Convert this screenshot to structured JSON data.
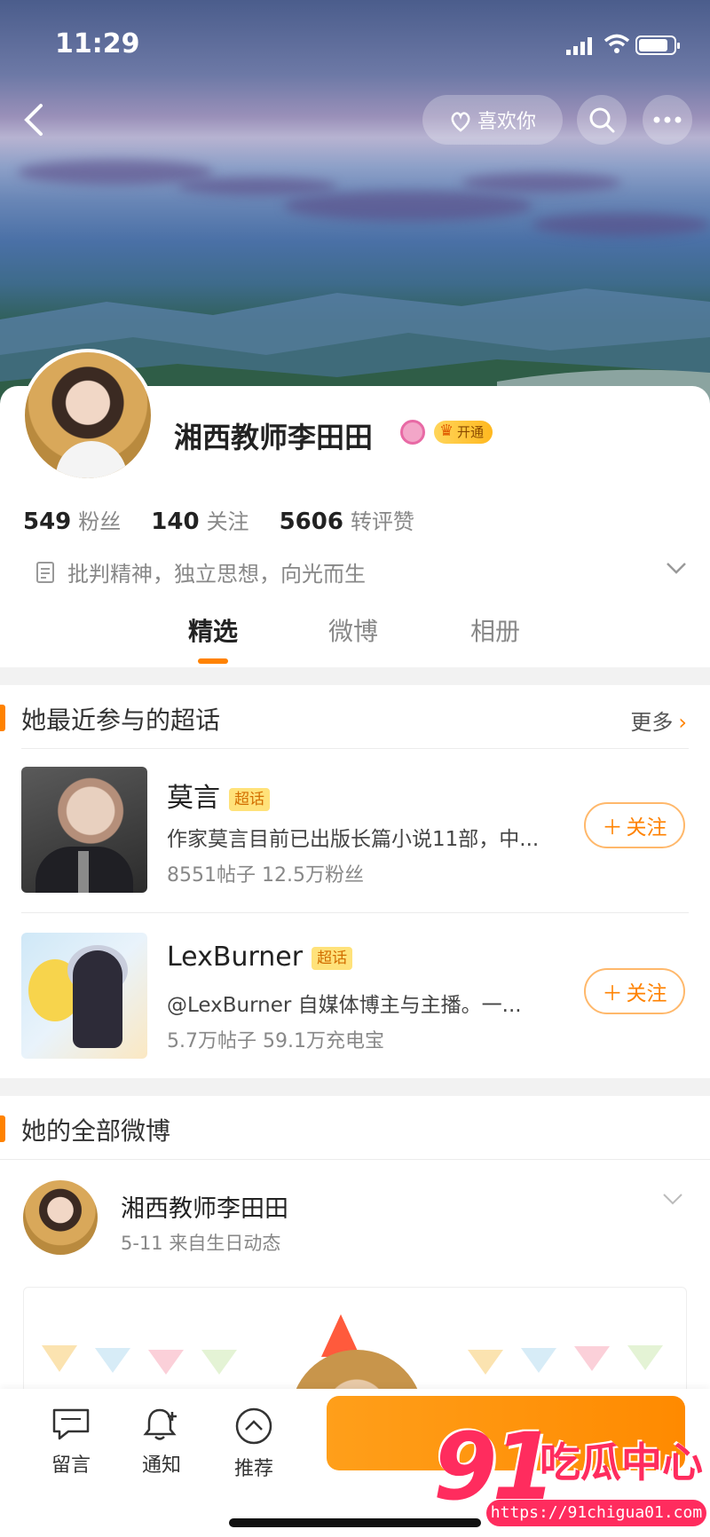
{
  "status_bar": {
    "time": "11:29"
  },
  "header": {
    "like_label": "喜欢你"
  },
  "profile": {
    "name": "湘西教师李田田",
    "open_badge": "开通",
    "stats": [
      {
        "value": "549",
        "label": "粉丝"
      },
      {
        "value": "140",
        "label": "关注"
      },
      {
        "value": "5606",
        "label": "转评赞"
      }
    ],
    "bio": "批判精神，独立思想，向光而生"
  },
  "tabs": [
    {
      "label": "精选"
    },
    {
      "label": "微博"
    },
    {
      "label": "相册"
    }
  ],
  "topics_section": {
    "title": "她最近参与的超话",
    "more_label": "更多",
    "items": [
      {
        "name": "莫言",
        "tag": "超话",
        "desc": "作家莫言目前已出版长篇小说11部，中...",
        "meta": "8551帖子 12.5万粉丝",
        "follow_label": "关注"
      },
      {
        "name": "LexBurner",
        "tag": "超话",
        "desc": "@LexBurner 自媒体博主与主播。一...",
        "meta": "5.7万帖子 59.1万充电宝",
        "follow_label": "关注"
      }
    ]
  },
  "weibo_section": {
    "title": "她的全部微博",
    "post": {
      "author": "湘西教师李田田",
      "meta": "5-11  来自生日动态"
    }
  },
  "toolbar": {
    "items": [
      {
        "label": "留言"
      },
      {
        "label": "通知"
      },
      {
        "label": "推荐"
      }
    ],
    "main_button_label": "关注"
  },
  "watermark": {
    "brand_num": "91",
    "brand_text": "吃瓜中心",
    "url": "https://91chigua01.com"
  },
  "colors": {
    "accent": "#ff8200",
    "topic_tag_bg": "#ffe27a",
    "watermark": "#ff2c5e"
  }
}
